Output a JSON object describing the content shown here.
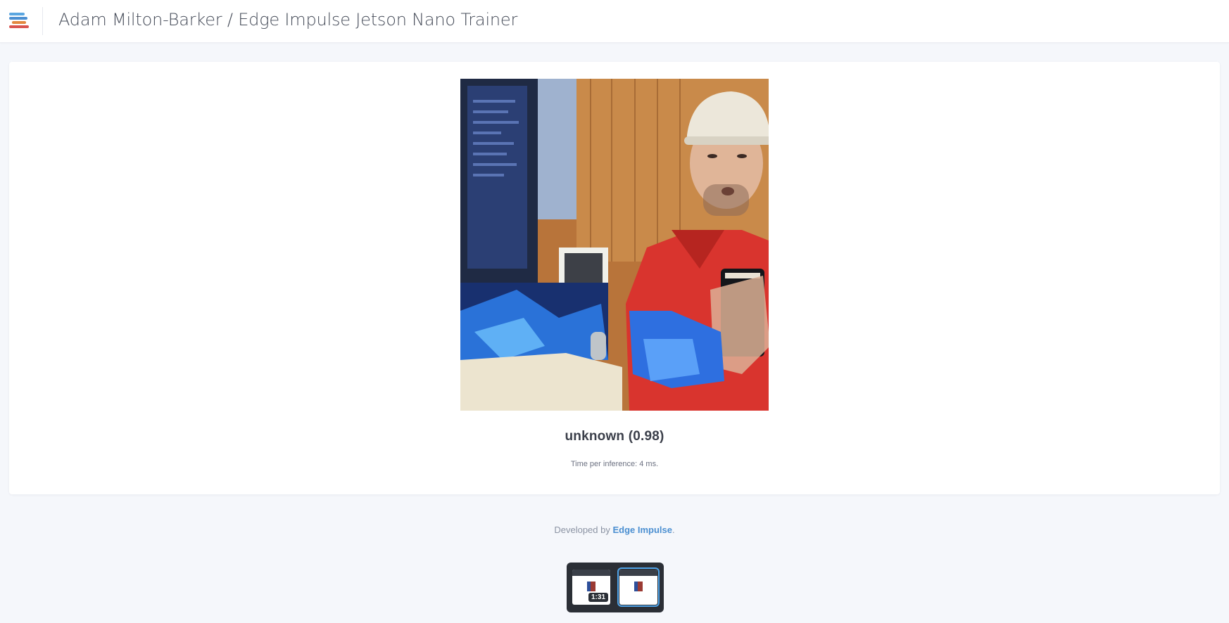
{
  "header": {
    "title": "Adam Milton-Barker / Edge Impulse Jetson Nano Trainer",
    "logo_icon": "edge-impulse-logo-icon"
  },
  "result": {
    "prediction": "unknown (0.98)",
    "inference_time": "Time per inference: 4 ms."
  },
  "footer": {
    "prefix": "Developed by ",
    "link_text": "Edge Impulse",
    "suffix": "."
  },
  "player": {
    "timestamp": "1:31"
  },
  "colors": {
    "accent": "#4b8fd1",
    "logo_blue": "#5aa6e0",
    "logo_orange": "#e3873f",
    "logo_red": "#d9534f"
  }
}
